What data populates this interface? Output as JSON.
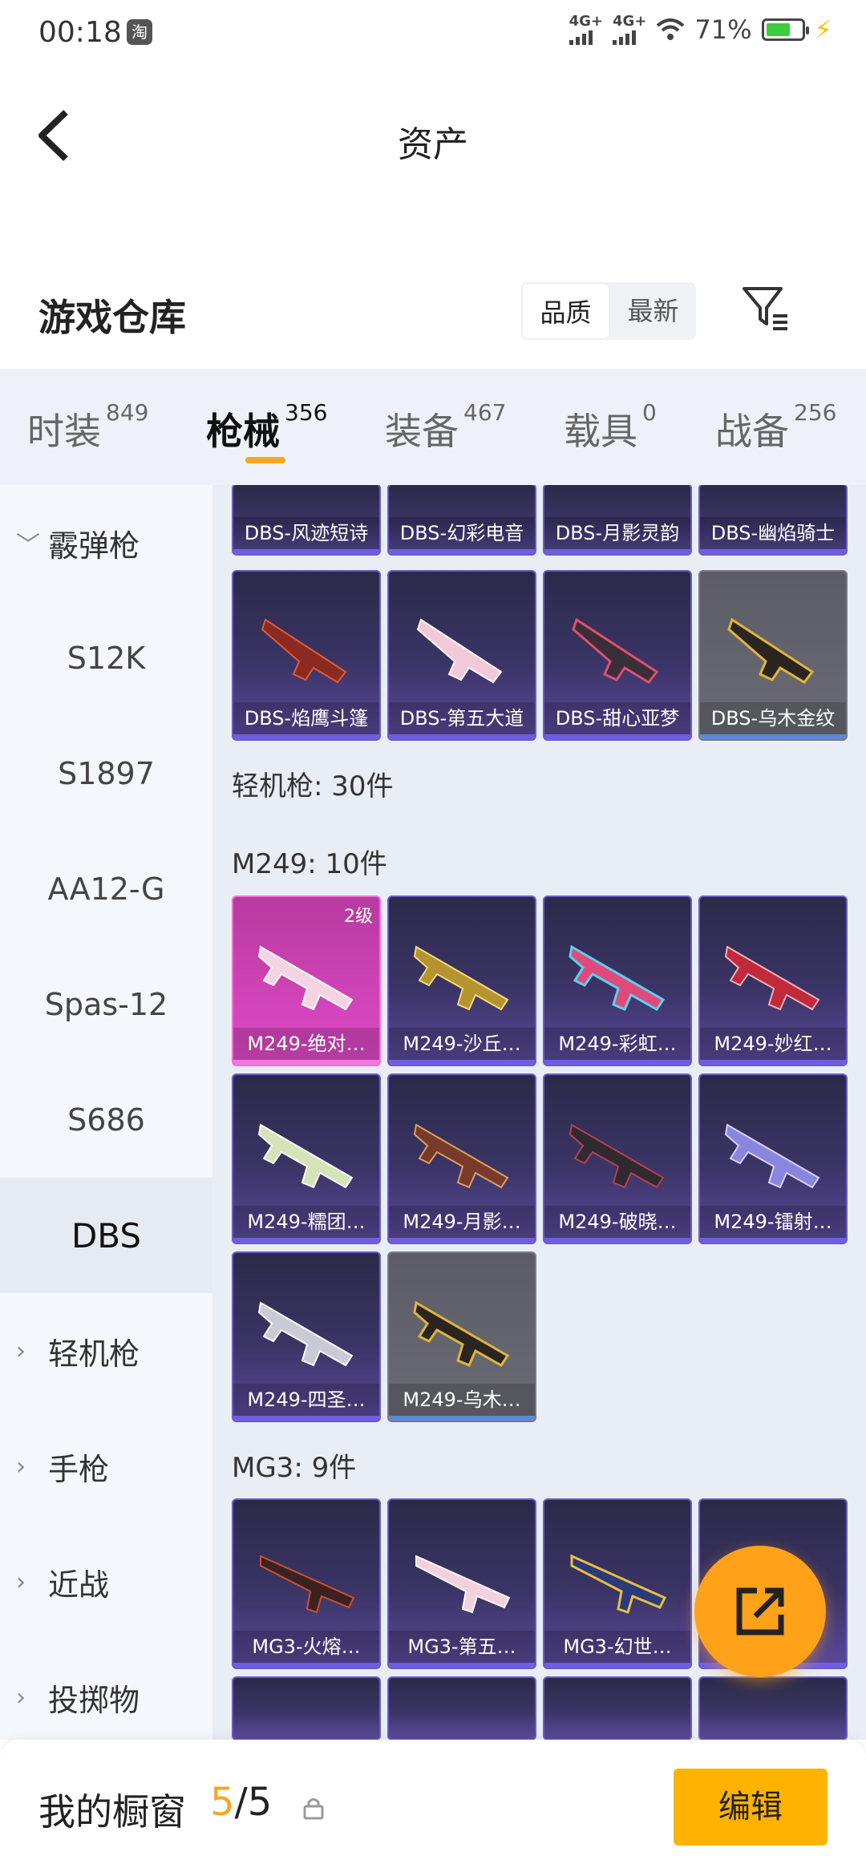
{
  "status_bar": {
    "time": "00:18",
    "taobao": "淘",
    "net1": "4G+",
    "net2": "4G+",
    "battery": "71%"
  },
  "header": {
    "title": "资产"
  },
  "warehouse": {
    "title": "游戏仓库",
    "sort_quality": "品质",
    "sort_latest": "最新"
  },
  "tabs": [
    {
      "label": "时装",
      "count": "849"
    },
    {
      "label": "枪械",
      "count": "356"
    },
    {
      "label": "装备",
      "count": "467"
    },
    {
      "label": "载具",
      "count": "0"
    },
    {
      "label": "战备",
      "count": "256"
    }
  ],
  "sidebar": {
    "group_open": "霰弹枪",
    "subs": [
      "S12K",
      "S1897",
      "AA12-G",
      "Spas-12",
      "S686",
      "DBS"
    ],
    "groups": [
      "轻机枪",
      "手枪",
      "近战",
      "投掷物"
    ]
  },
  "content": {
    "dbs_row1": [
      "DBS-风迹短诗",
      "DBS-幻彩电音",
      "DBS-月影灵韵",
      "DBS-幽焰骑士"
    ],
    "dbs_row2": [
      "DBS-焰鹰斗篷",
      "DBS-第五大道",
      "DBS-甜心亚梦",
      "DBS-乌木金纹"
    ],
    "section_lmg": "轻机枪: 30件",
    "section_m249": "M249: 10件",
    "m249": [
      "M249-绝对…",
      "M249-沙丘…",
      "M249-彩虹…",
      "M249-妙红…",
      "M249-糯团…",
      "M249-月影…",
      "M249-破晓…",
      "M249-镭射…",
      "M249-四圣…",
      "M249-乌木…"
    ],
    "m249_level": "2级",
    "section_mg3": "MG3: 9件",
    "mg3": [
      "MG3-火熔…",
      "MG3-第五…",
      "MG3-幻世…"
    ]
  },
  "bottom": {
    "label": "我的橱窗",
    "current": "5",
    "total": "/5",
    "edit": "编辑"
  }
}
